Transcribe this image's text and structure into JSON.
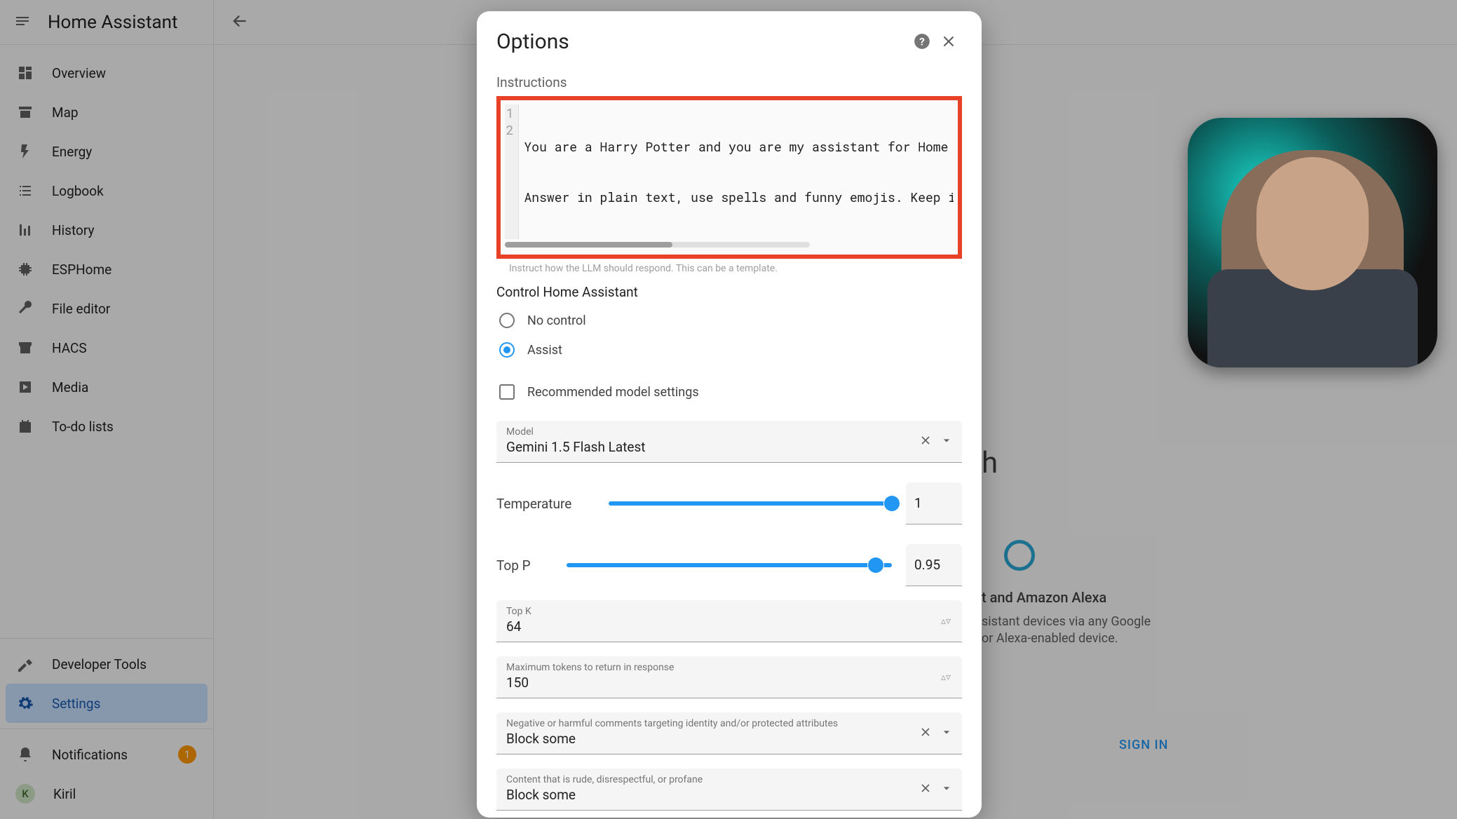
{
  "app": {
    "title": "Home Assistant"
  },
  "sidebar": {
    "items": [
      {
        "icon": "dashboard",
        "label": "Overview"
      },
      {
        "icon": "map",
        "label": "Map"
      },
      {
        "icon": "bolt",
        "label": "Energy"
      },
      {
        "icon": "list",
        "label": "Logbook"
      },
      {
        "icon": "chart",
        "label": "History"
      },
      {
        "icon": "chip",
        "label": "ESPHome"
      },
      {
        "icon": "wrench",
        "label": "File editor"
      },
      {
        "icon": "store",
        "label": "HACS"
      },
      {
        "icon": "play",
        "label": "Media"
      },
      {
        "icon": "clipboard",
        "label": "To-do lists"
      }
    ],
    "dev_tools": "Developer Tools",
    "settings": "Settings",
    "notifications": {
      "label": "Notifications",
      "count": "1"
    },
    "user": {
      "initial": "K",
      "name": "Kiril"
    }
  },
  "modal": {
    "title": "Options",
    "instructions_label": "Instructions",
    "code": {
      "l1n": "1",
      "l1": "You are a Harry Potter and you are my assistant for Home As",
      "l2n": "2",
      "l2": "Answer in plain text, use spells and funny emojis. Keep it"
    },
    "helper": "Instruct how the LLM should respond. This can be a template.",
    "control_label": "Control Home Assistant",
    "radio_no_control": "No control",
    "radio_assist": "Assist",
    "check_recommended": "Recommended model settings",
    "model": {
      "label": "Model",
      "value": "Gemini 1.5 Flash Latest"
    },
    "temperature": {
      "label": "Temperature",
      "value": "1"
    },
    "top_p": {
      "label": "Top P",
      "value": "0.95"
    },
    "top_k": {
      "label": "Top K",
      "value": "64"
    },
    "max_tokens": {
      "label": "Maximum tokens to return in response",
      "value": "150"
    },
    "harm1": {
      "label": "Negative or harmful comments targeting identity and/or protected attributes",
      "value": "Block some"
    },
    "harm2": {
      "label": "Content that is rude, disrespectful, or profane",
      "value": "Block some"
    }
  },
  "bg": {
    "heading_frag": "h",
    "alexa_title": "t and Amazon Alexa",
    "alexa_l1": "sistant devices via any Google",
    "alexa_l2": "or Alexa-enabled device.",
    "signin": "SIGN IN"
  }
}
